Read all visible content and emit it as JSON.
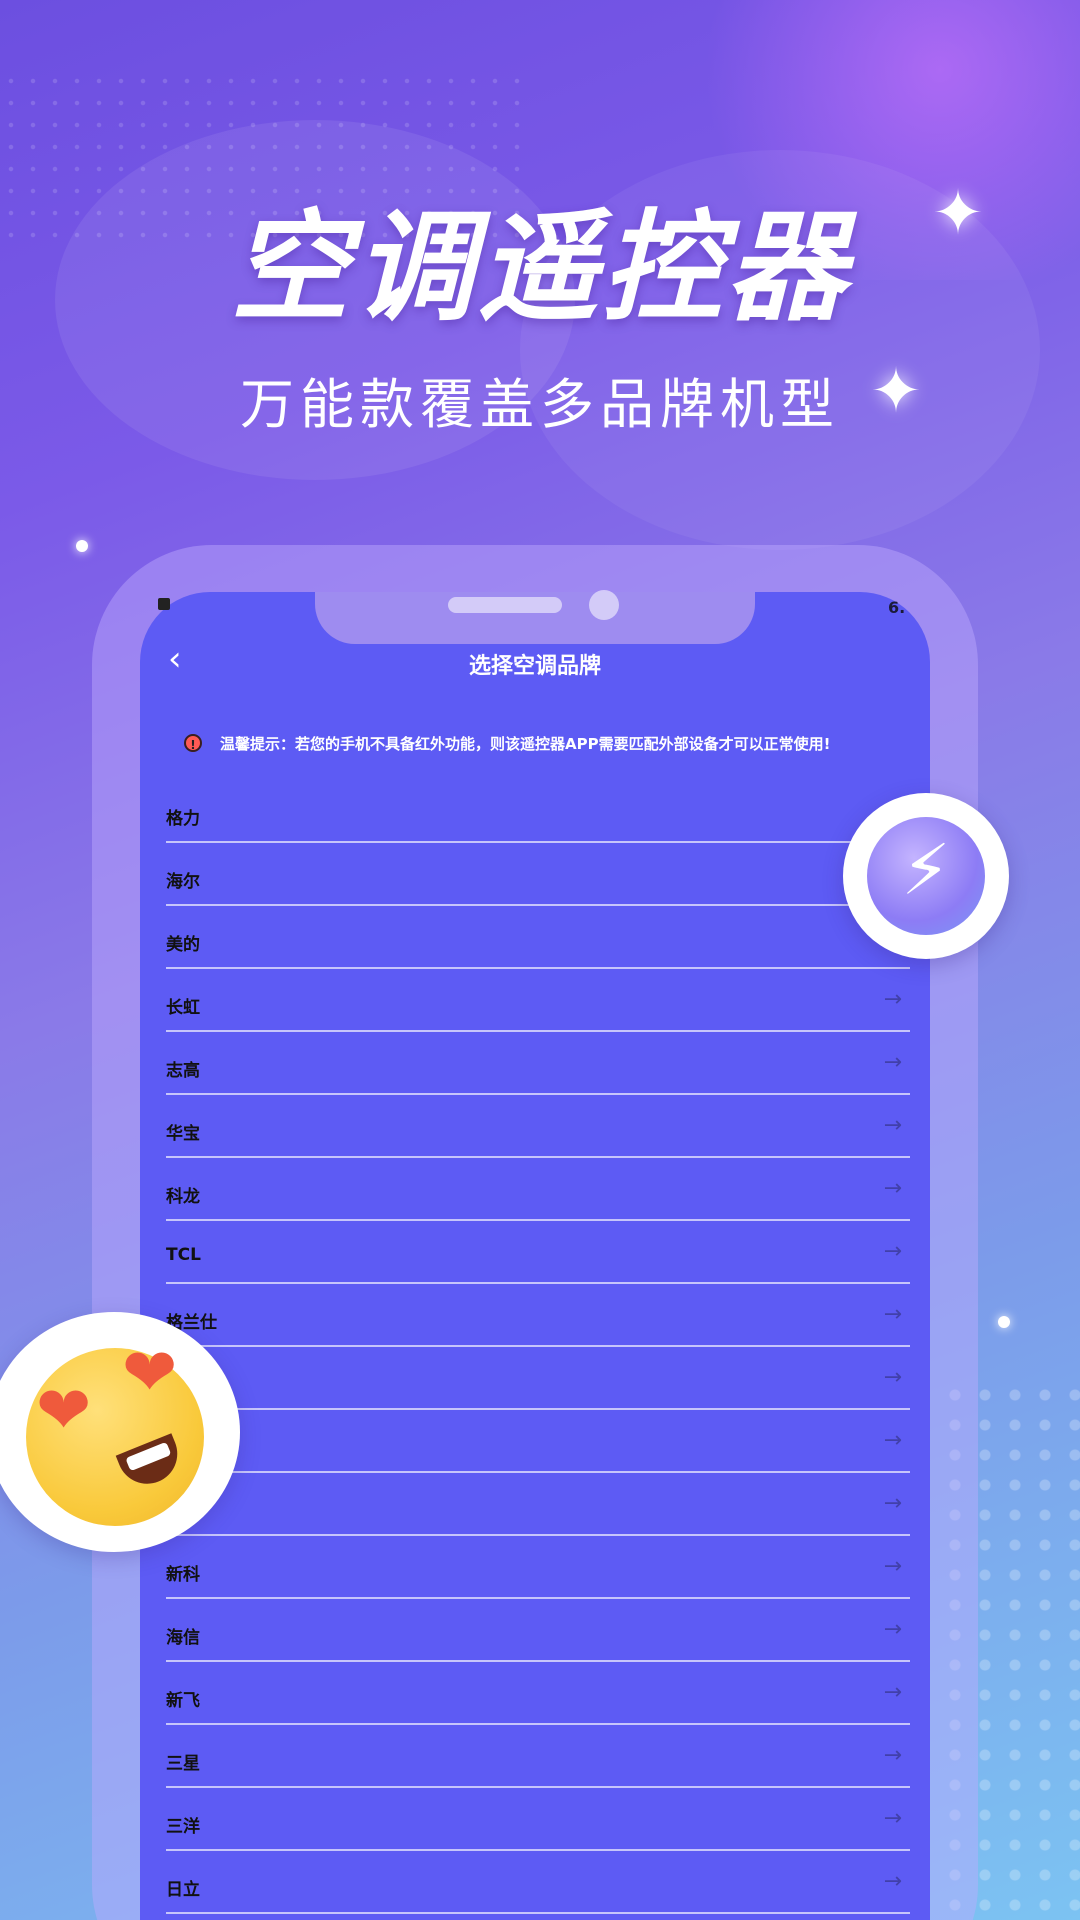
{
  "promo": {
    "headline": "空调遥控器",
    "subline": "万能款覆盖多品牌机型"
  },
  "status_bar": {
    "right_text": "6."
  },
  "nav": {
    "back_icon": "chevron-left-icon",
    "title": "选择空调品牌"
  },
  "notice": {
    "icon": "alert-icon",
    "icon_glyph": "!",
    "text": "温馨提示：若您的手机不具备红外功能，则该遥控器APP需要匹配外部设备才可以正常使用!"
  },
  "brands": [
    "格力",
    "海尔",
    "美的",
    "长虹",
    "志高",
    "华宝",
    "科龙",
    "TCL",
    "格兰仕",
    "",
    "",
    "",
    "新科",
    "海信",
    "新飞",
    "三星",
    "三洋",
    "日立"
  ],
  "glyphs": {
    "arrow": "→",
    "back": "‹",
    "sparkle": "✦",
    "bolt": "⚡",
    "heart": "❤"
  },
  "colors": {
    "screen_bg": "#5d5bf4",
    "accent_purple": "#8d7cf5",
    "notice_icon": "#ff5a55"
  }
}
